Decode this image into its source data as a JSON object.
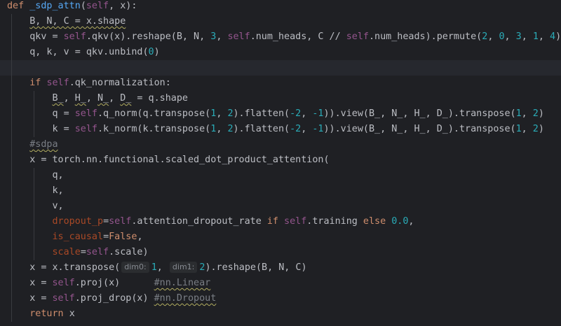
{
  "editor": {
    "lines": [
      [
        {
          "t": "def ",
          "c": "kw"
        },
        {
          "t": "_sdp_attn",
          "c": "fn"
        },
        {
          "t": "("
        },
        {
          "t": "self",
          "c": "self"
        },
        {
          "t": ", x):"
        }
      ],
      [
        {
          "t": "    "
        },
        {
          "t": "B, N, C = x.shape",
          "c": "warn"
        }
      ],
      [
        {
          "t": "    qkv = "
        },
        {
          "t": "self",
          "c": "self"
        },
        {
          "t": ".qkv(x).reshape(B, N, "
        },
        {
          "t": "3",
          "c": "num"
        },
        {
          "t": ", "
        },
        {
          "t": "self",
          "c": "self"
        },
        {
          "t": ".num_heads, C // "
        },
        {
          "t": "self",
          "c": "self"
        },
        {
          "t": ".num_heads).permute("
        },
        {
          "t": "2",
          "c": "num"
        },
        {
          "t": ", "
        },
        {
          "t": "0",
          "c": "num"
        },
        {
          "t": ", "
        },
        {
          "t": "3",
          "c": "num"
        },
        {
          "t": ", "
        },
        {
          "t": "1",
          "c": "num"
        },
        {
          "t": ", "
        },
        {
          "t": "4",
          "c": "num"
        },
        {
          "t": ")"
        }
      ],
      [
        {
          "t": "    q, k, v = qkv.unbind("
        },
        {
          "t": "0",
          "c": "num"
        },
        {
          "t": ")"
        }
      ],
      [],
      [
        {
          "t": "    "
        },
        {
          "t": "if ",
          "c": "kw"
        },
        {
          "t": "self",
          "c": "self"
        },
        {
          "t": ".qk_normalization:"
        }
      ],
      [
        {
          "t": "        "
        },
        {
          "t": "B_",
          "c": "warn"
        },
        {
          "t": ", "
        },
        {
          "t": "H_",
          "c": "warn"
        },
        {
          "t": ", "
        },
        {
          "t": "N_",
          "c": "warn"
        },
        {
          "t": ", "
        },
        {
          "t": "D_",
          "c": "warn"
        },
        {
          "t": " = q.shape"
        }
      ],
      [
        {
          "t": "        q = "
        },
        {
          "t": "self",
          "c": "self"
        },
        {
          "t": ".q_norm(q.transpose("
        },
        {
          "t": "1",
          "c": "num"
        },
        {
          "t": ", "
        },
        {
          "t": "2",
          "c": "num"
        },
        {
          "t": ").flatten("
        },
        {
          "t": "-2",
          "c": "num"
        },
        {
          "t": ", "
        },
        {
          "t": "-1",
          "c": "num"
        },
        {
          "t": ")).view(B_, N_, H_, D_).transpose("
        },
        {
          "t": "1",
          "c": "num"
        },
        {
          "t": ", "
        },
        {
          "t": "2",
          "c": "num"
        },
        {
          "t": ")"
        }
      ],
      [
        {
          "t": "        k = "
        },
        {
          "t": "self",
          "c": "self"
        },
        {
          "t": ".k_norm(k.transpose("
        },
        {
          "t": "1",
          "c": "num"
        },
        {
          "t": ", "
        },
        {
          "t": "2",
          "c": "num"
        },
        {
          "t": ").flatten("
        },
        {
          "t": "-2",
          "c": "num"
        },
        {
          "t": ", "
        },
        {
          "t": "-1",
          "c": "num"
        },
        {
          "t": ")).view(B_, N_, H_, D_).transpose("
        },
        {
          "t": "1",
          "c": "num"
        },
        {
          "t": ", "
        },
        {
          "t": "2",
          "c": "num"
        },
        {
          "t": ")"
        }
      ],
      [
        {
          "t": "    "
        },
        {
          "t": "#sdpa",
          "c": "comment warn"
        }
      ],
      [
        {
          "t": "    x = torch.nn.functional.scaled_dot_product_attention("
        }
      ],
      [
        {
          "t": "        q,"
        }
      ],
      [
        {
          "t": "        k,"
        }
      ],
      [
        {
          "t": "        v,"
        }
      ],
      [
        {
          "t": "        "
        },
        {
          "t": "dropout_p",
          "c": "param"
        },
        {
          "t": "="
        },
        {
          "t": "self",
          "c": "self"
        },
        {
          "t": ".attention_dropout_rate "
        },
        {
          "t": "if ",
          "c": "kw"
        },
        {
          "t": "self",
          "c": "self"
        },
        {
          "t": ".training "
        },
        {
          "t": "else ",
          "c": "kw"
        },
        {
          "t": "0.0",
          "c": "num"
        },
        {
          "t": ","
        }
      ],
      [
        {
          "t": "        "
        },
        {
          "t": "is_causal",
          "c": "param"
        },
        {
          "t": "="
        },
        {
          "t": "False",
          "c": "kw"
        },
        {
          "t": ","
        }
      ],
      [
        {
          "t": "        "
        },
        {
          "t": "scale",
          "c": "param"
        },
        {
          "t": "="
        },
        {
          "t": "self",
          "c": "self"
        },
        {
          "t": ".scale)"
        }
      ],
      [
        {
          "t": "    x = x.transpose("
        },
        {
          "h": "dim0:"
        },
        {
          "t": "1",
          "c": "num"
        },
        {
          "t": ", "
        },
        {
          "h": "dim1:"
        },
        {
          "t": "2",
          "c": "num"
        },
        {
          "t": ").reshape(B, N, C)"
        }
      ],
      [
        {
          "t": "    x = "
        },
        {
          "t": "self",
          "c": "self"
        },
        {
          "t": ".proj(x)      "
        },
        {
          "t": "#nn.Linear",
          "c": "comment warn"
        }
      ],
      [
        {
          "t": "    x = "
        },
        {
          "t": "self",
          "c": "self"
        },
        {
          "t": ".proj_drop(x) "
        },
        {
          "t": "#nn.Dropout",
          "c": "comment warn"
        }
      ],
      [
        {
          "t": "    "
        },
        {
          "t": "return ",
          "c": "kw"
        },
        {
          "t": "x"
        }
      ]
    ],
    "current_line": 4,
    "colors": {
      "background": "#1f2024",
      "keyword": "#cf8e6d",
      "function": "#56a8f5",
      "self": "#94558d",
      "number": "#2aacb8",
      "param": "#aa4926",
      "comment": "#7a7e85"
    }
  }
}
